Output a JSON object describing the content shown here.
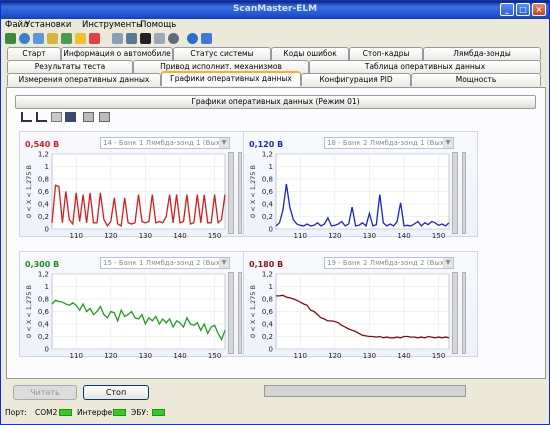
{
  "window": {
    "title": "ScanMaster-ELM"
  },
  "menu": [
    "Файл",
    "Установки",
    "Инструменты",
    "Помощь"
  ],
  "tabs": {
    "row1": [
      "Старт",
      "Информация о автомобиле",
      "Статус системы",
      "Коды ошибок",
      "Стоп-кадры",
      "Лямбда-зонды"
    ],
    "row2": [
      "Результаты теста",
      "Привод исполнит. механизмов",
      "Таблица оперативных данных"
    ],
    "row3": [
      "Измерения оперативных данных",
      "Графики оперативных данных",
      "Конфигурация PID",
      "Мощность"
    ],
    "active": "Графики оперативных данных"
  },
  "panel_title": "Графики оперативных данных (Режим 01)",
  "charts": [
    {
      "value": "0,540 В",
      "value_color": "#cc1f1f",
      "line_color": "#d21e1e",
      "sensor": "14 - Банк 1 Лямбда-зонд 1 (Выходно",
      "ylabel": "0 < X < 1,275 В"
    },
    {
      "value": "0,120 В",
      "value_color": "#1d2bc4",
      "line_color": "#1a24c8",
      "sensor": "18 - Банк 2 Лямбда-зонд 1 (Выходно",
      "ylabel": "0 < X < 1,275 В"
    },
    {
      "value": "0,300 В",
      "value_color": "#1b8a1b",
      "line_color": "#229922",
      "sensor": "15 - Банк 1 Лямбда-зонд 2 (Выходно",
      "ylabel": "0 < X < 1,275 В"
    },
    {
      "value": "0,180 В",
      "value_color": "#8a1515",
      "line_color": "#7a1010",
      "sensor": "19 - Банк 2 Лямбда-зонд 2 (Выходно",
      "ylabel": "0 < X < 1,275 В"
    }
  ],
  "chart_data": [
    {
      "type": "line",
      "xlim": [
        103,
        153
      ],
      "ylim": [
        0,
        1.2
      ],
      "xticks": [
        110,
        120,
        130,
        140,
        150
      ],
      "yticks": [
        "0",
        "0,2",
        "0,4",
        "0,6",
        "0,8",
        "1",
        "1,2"
      ],
      "series": [
        {
          "x": [
            103,
            104,
            105,
            106,
            107,
            108,
            109,
            110,
            111,
            112,
            113,
            114,
            115,
            116,
            117,
            118,
            119,
            120,
            121,
            122,
            123,
            124,
            125,
            126,
            127,
            128,
            129,
            130,
            131,
            132,
            133,
            134,
            135,
            136,
            137,
            138,
            139,
            140,
            141,
            142,
            143,
            144,
            145,
            146,
            147,
            148,
            149,
            150,
            151,
            152,
            153
          ],
          "values": [
            0.1,
            0.7,
            0.68,
            0.1,
            0.6,
            0.15,
            0.08,
            0.58,
            0.12,
            0.55,
            0.1,
            0.58,
            0.1,
            0.1,
            0.58,
            0.15,
            0.05,
            0.12,
            0.5,
            0.08,
            0.05,
            0.5,
            0.1,
            0.08,
            0.1,
            0.55,
            0.12,
            0.1,
            0.12,
            0.55,
            0.1,
            0.12,
            0.1,
            0.2,
            0.55,
            0.1,
            0.55,
            0.1,
            0.12,
            0.55,
            0.08,
            0.1,
            0.55,
            0.1,
            0.55,
            0.1,
            0.1,
            0.55,
            0.1,
            0.15,
            0.55
          ]
        }
      ]
    },
    {
      "type": "line",
      "xlim": [
        103,
        153
      ],
      "ylim": [
        0,
        1.2
      ],
      "xticks": [
        110,
        120,
        130,
        140,
        150
      ],
      "yticks": [
        "0",
        "0,2",
        "0,4",
        "0,6",
        "0,8",
        "1",
        "1,2"
      ],
      "series": [
        {
          "x": [
            103,
            104,
            105,
            106,
            107,
            108,
            109,
            110,
            111,
            112,
            113,
            114,
            115,
            116,
            117,
            118,
            119,
            120,
            121,
            122,
            123,
            124,
            125,
            126,
            127,
            128,
            129,
            130,
            131,
            132,
            133,
            134,
            135,
            136,
            137,
            138,
            139,
            140,
            141,
            142,
            143,
            144,
            145,
            146,
            147,
            148,
            149,
            150,
            151,
            152,
            153
          ],
          "values": [
            0.05,
            0.1,
            0.3,
            0.72,
            0.35,
            0.15,
            0.08,
            0.06,
            0.05,
            0.08,
            0.05,
            0.06,
            0.1,
            0.05,
            0.08,
            0.18,
            0.05,
            0.06,
            0.08,
            0.12,
            0.05,
            0.08,
            0.35,
            0.05,
            0.06,
            0.1,
            0.05,
            0.25,
            0.05,
            0.07,
            0.55,
            0.1,
            0.05,
            0.08,
            0.05,
            0.12,
            0.42,
            0.05,
            0.06,
            0.05,
            0.08,
            0.12,
            0.05,
            0.1,
            0.07,
            0.12,
            0.1,
            0.06,
            0.08,
            0.05,
            0.1
          ]
        }
      ]
    },
    {
      "type": "line",
      "xlim": [
        103,
        153
      ],
      "ylim": [
        0,
        1.2
      ],
      "xticks": [
        110,
        120,
        130,
        140,
        150
      ],
      "yticks": [
        "0",
        "0,2",
        "0,4",
        "0,6",
        "0,8",
        "1",
        "1,2"
      ],
      "series": [
        {
          "x": [
            103,
            104,
            105,
            106,
            107,
            108,
            109,
            110,
            111,
            112,
            113,
            114,
            115,
            116,
            117,
            118,
            119,
            120,
            121,
            122,
            123,
            124,
            125,
            126,
            127,
            128,
            129,
            130,
            131,
            132,
            133,
            134,
            135,
            136,
            137,
            138,
            139,
            140,
            141,
            142,
            143,
            144,
            145,
            146,
            147,
            148,
            149,
            150,
            151,
            152,
            153
          ],
          "values": [
            0.72,
            0.78,
            0.76,
            0.75,
            0.72,
            0.7,
            0.74,
            0.7,
            0.62,
            0.72,
            0.6,
            0.65,
            0.55,
            0.6,
            0.68,
            0.55,
            0.5,
            0.6,
            0.58,
            0.45,
            0.62,
            0.52,
            0.55,
            0.6,
            0.5,
            0.48,
            0.55,
            0.4,
            0.5,
            0.45,
            0.52,
            0.4,
            0.48,
            0.42,
            0.48,
            0.35,
            0.45,
            0.42,
            0.35,
            0.5,
            0.4,
            0.38,
            0.42,
            0.3,
            0.4,
            0.25,
            0.35,
            0.38,
            0.25,
            0.15,
            0.3
          ]
        }
      ]
    },
    {
      "type": "line",
      "xlim": [
        103,
        153
      ],
      "ylim": [
        0,
        1.2
      ],
      "xticks": [
        110,
        120,
        130,
        140,
        150
      ],
      "yticks": [
        "0",
        "0,2",
        "0,4",
        "0,6",
        "0,8",
        "1",
        "1,2"
      ],
      "series": [
        {
          "x": [
            103,
            104,
            105,
            106,
            107,
            108,
            109,
            110,
            111,
            112,
            113,
            114,
            115,
            116,
            117,
            118,
            119,
            120,
            121,
            122,
            123,
            124,
            125,
            126,
            127,
            128,
            129,
            130,
            131,
            132,
            133,
            134,
            135,
            136,
            137,
            138,
            139,
            140,
            141,
            142,
            143,
            144,
            145,
            146,
            147,
            148,
            149,
            150,
            151,
            152,
            153
          ],
          "values": [
            0.85,
            0.85,
            0.86,
            0.83,
            0.82,
            0.8,
            0.78,
            0.75,
            0.72,
            0.7,
            0.62,
            0.6,
            0.55,
            0.5,
            0.48,
            0.45,
            0.45,
            0.44,
            0.42,
            0.38,
            0.35,
            0.32,
            0.3,
            0.28,
            0.25,
            0.22,
            0.21,
            0.2,
            0.2,
            0.19,
            0.2,
            0.18,
            0.19,
            0.18,
            0.18,
            0.19,
            0.18,
            0.2,
            0.2,
            0.19,
            0.19,
            0.18,
            0.19,
            0.18,
            0.2,
            0.19,
            0.18,
            0.19,
            0.18,
            0.19,
            0.18
          ]
        }
      ]
    }
  ],
  "buttons": {
    "read": "Читать",
    "stop": "Стоп"
  },
  "status": {
    "port_label": "Порт:",
    "port": "COM2",
    "interface": "Интерфейс",
    "ecu": "ЭБУ:"
  }
}
